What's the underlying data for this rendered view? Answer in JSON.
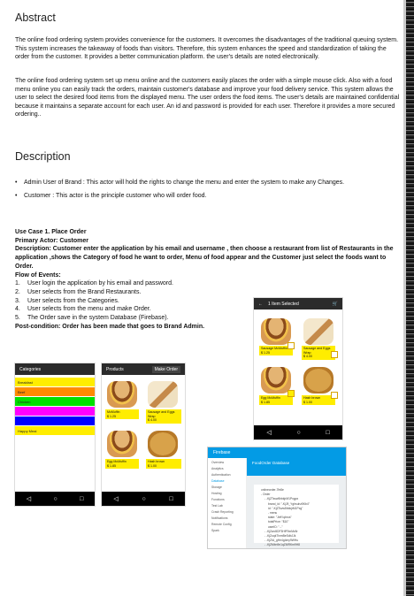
{
  "abstract": {
    "heading": "Abstract",
    "p1": "The online food ordering system provides convenience for the customers. It overcomes the disadvantages of the traditional queuing system. This system increases the takeaway of foods than visitors. Therefore, this system enhances the speed and standardization of taking the order from the customer. It provides a better communication platform. the user's details are noted electronically.",
    "p2": "The online food ordering system set up menu online and the customers easily places the order with a simple mouse click. Also with a food menu online you can easily track the orders, maintain customer's database and improve your food delivery service. This system allows the user to select the desired food items from the displayed menu. The user orders the food items. The user's details are maintained confidential because it maintains a separate account for each user. An id and password is provided for each user. Therefore it provides a more secured ordering.."
  },
  "description": {
    "heading": "Description",
    "bullets": [
      "Admin User of Brand : This actor will hold the rights to change the menu and enter the system to make any Changes.",
      "Customer : This actor is the principle customer who will order food."
    ]
  },
  "use_case": {
    "title": "Use Case 1. Place Order",
    "actor_label": "Primary Actor:",
    "actor_value": "Customer",
    "desc_label": "Description:",
    "desc_value": "Customer enter the application by his email and username , then choose a restaurant from list of Restaurants  in the application ,shows the Category of food he want to order, Menu of food appear and the Customer just select the foods want to Order.",
    "flow_label": "Flow of Events:",
    "flow": [
      {
        "n": "1.",
        "t": "User login the application by his email and password."
      },
      {
        "n": "2.",
        "t": "User selects from the Brand Restaurants."
      },
      {
        "n": "3.",
        "t": "User selects from the Categories."
      },
      {
        "n": "4.",
        "t": "User selects from the menu and make Order."
      },
      {
        "n": "5.",
        "t": "The Order save in the system Database (Firebase)."
      }
    ],
    "post_label": "Post-condition:",
    "post_value": "Order has been made that goes to Brand Admin."
  },
  "phone_selected": {
    "title": "1 Item Selected",
    "items": [
      {
        "name": "Sausage McMuffin",
        "price": "$ 1.25"
      },
      {
        "name": "Sausage and Eggs Wrap",
        "price": "$ 4.00"
      },
      {
        "name": "Egg McMuffin",
        "price": "$ 1.85"
      },
      {
        "name": "Hash brown",
        "price": "$ 1.00"
      }
    ]
  },
  "phone_categories": {
    "header": "Categories",
    "categories": [
      {
        "label": "Breakfast",
        "color": "#ffed00"
      },
      {
        "label": "Beef",
        "color": "#ff8a00"
      },
      {
        "label": "Chicken",
        "color": "#00e000"
      },
      {
        "label": "",
        "color": "#ff00ff"
      },
      {
        "label": "",
        "color": "#0000ff"
      },
      {
        "label": "Happy Meal",
        "color": "#ffed00"
      }
    ]
  },
  "phone_products": {
    "header": "Products",
    "button": "Make Order",
    "items": [
      {
        "name": "McMuffin",
        "price": "$ 1.25"
      },
      {
        "name": "Sausage and Eggs Wrap",
        "price": "$ 4.00"
      },
      {
        "name": "Egg McMuffin",
        "price": "$ 1.85"
      },
      {
        "name": "Hash brown",
        "price": "$ 1.00"
      }
    ]
  },
  "firebase": {
    "brand": "Firebase",
    "project": "FoodOrder Database",
    "menu": [
      "Overview",
      "Analytics",
      "Authentication",
      "Database",
      "Storage",
      "Hosting",
      "Functions",
      "Test Lab",
      "Crash Reporting",
      "Notifications",
      "Remote Config",
      "Spark"
    ],
    "data_lines": [
      "onlineorder-7fe8e",
      "- Order",
      "- -KjZTsvw5hbkjrM1Pxgpx",
      "brand_id: \"-KjJ9_Yghsuhz5Kb4\"",
      "id: \"-KjZTsvw5hbkjrM1Pxg\"",
      "- menu",
      "state: \"Jeff Iqbros\"",
      "totalPrice: \"$10\"",
      "userID: \"...\"",
      "- -KjZwo5DF3HfF9xrMz5r",
      "- -KjZuqkTinmBeSdbJJk",
      "- -KjZIA_gHe4g4my9WHu",
      "- -KjZMbn9n1qZ6IRKm9H8"
    ]
  }
}
